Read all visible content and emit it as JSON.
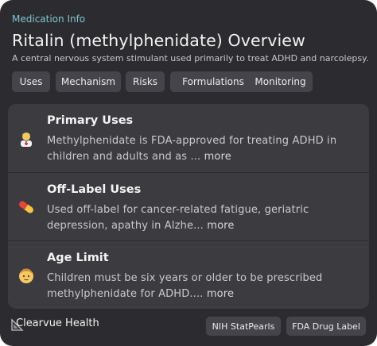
{
  "header": {
    "kicker": "Medication Info",
    "title": "Ritalin (methylphenidate) Overview",
    "subtitle": "A central nervous system stimulant used primarily to treat ADHD and narcolepsy."
  },
  "tabs": [
    {
      "label": "Uses"
    },
    {
      "label": "Mechanism"
    },
    {
      "label": "Risks"
    },
    {
      "label": "Formulations"
    },
    {
      "label": "Monitoring"
    }
  ],
  "sections": [
    {
      "icon": "health-worker-emoji",
      "title": "Primary Uses",
      "body": "Methylphenidate is FDA-approved for treating ADHD in children and adults and as ...",
      "more": "more"
    },
    {
      "icon": "pill-capsule-emoji",
      "title": "Off-Label Uses",
      "body": "Used off-label for cancer-related fatigue, geriatric depression, apathy in Alzhe...",
      "more": "more"
    },
    {
      "icon": "child-face-emoji",
      "title": "Age Limit",
      "body": "Children must be six years or older to be prescribed methylphenidate for ADHD....",
      "more": "more"
    }
  ],
  "footer": {
    "brand": "Clearvue Health",
    "sources": [
      {
        "label": "NIH StatPearls"
      },
      {
        "label": "FDA Drug Label"
      }
    ]
  },
  "colors": {
    "card_bg": "#2c2c30",
    "panel_bg": "#3b3b40",
    "chip_bg": "#44444a",
    "accent": "#7fc6d0"
  }
}
